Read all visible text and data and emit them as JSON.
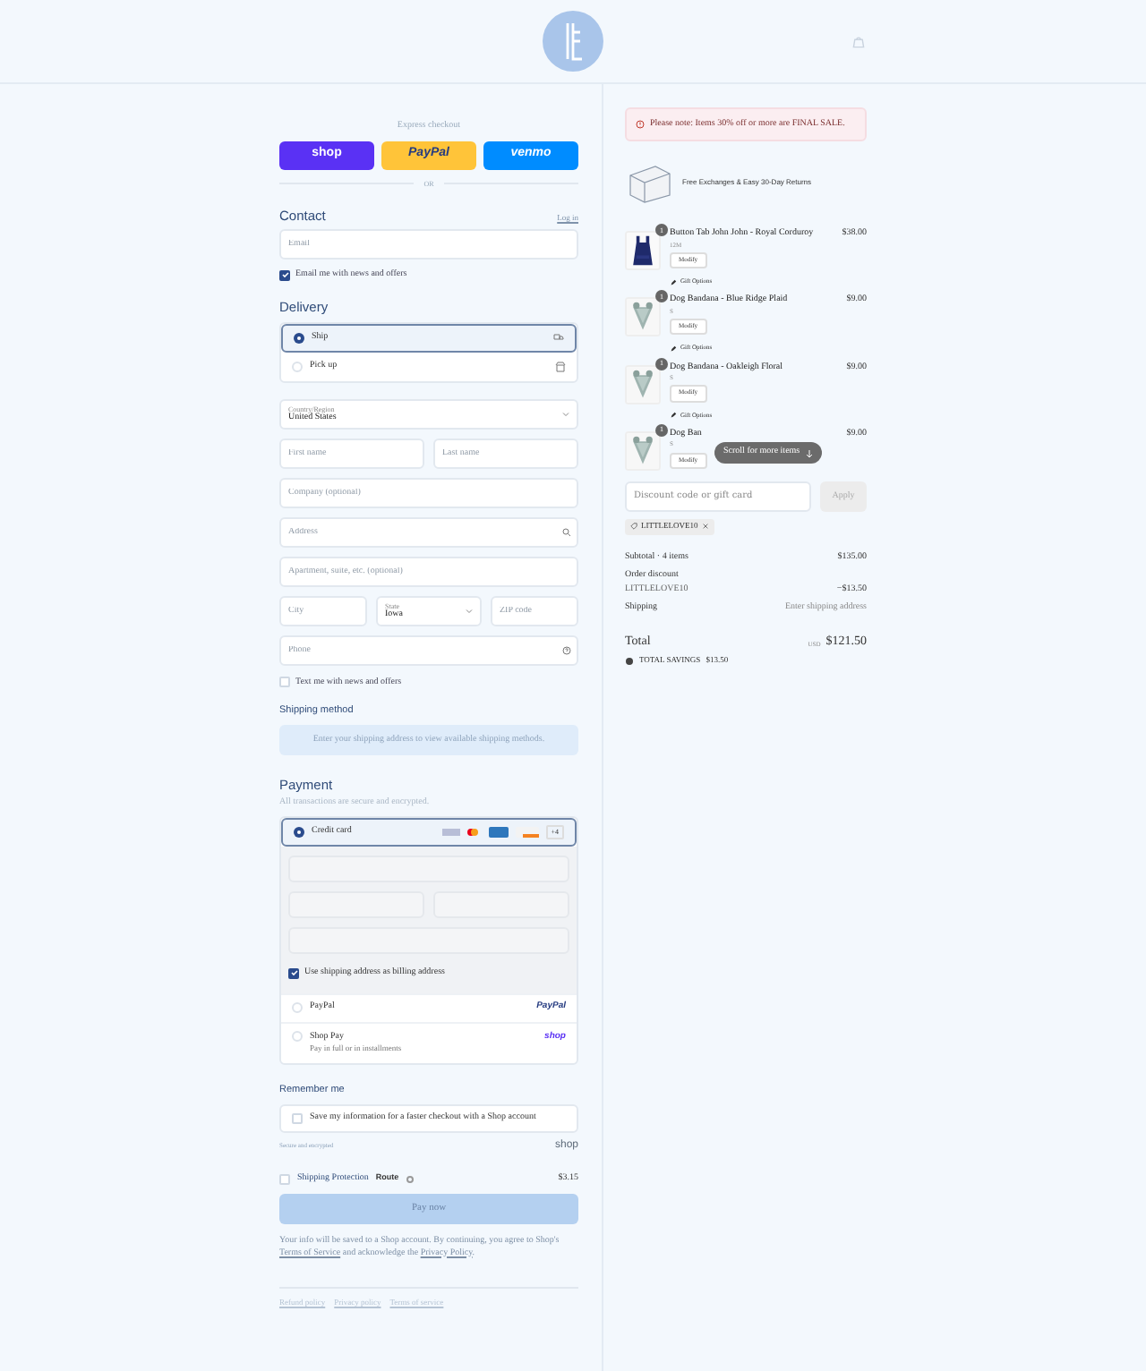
{
  "express": {
    "label": "Express checkout",
    "buttons": [
      {
        "kind": "shop",
        "label": "shop"
      },
      {
        "kind": "paypal",
        "label": "PayPal"
      },
      {
        "kind": "venmo",
        "label": "venmo"
      }
    ],
    "divider": "OR"
  },
  "contact": {
    "title": "Contact",
    "link": "Log in",
    "email": {
      "placeholder": "Email"
    },
    "newsletter": {
      "label": "Email me with news and offers",
      "checked": true
    }
  },
  "delivery": {
    "title": "Delivery",
    "options": [
      {
        "label": "Ship",
        "selected": true
      },
      {
        "label": "Pick up",
        "selected": false
      }
    ],
    "country": {
      "label": "Country/Region",
      "value": "United States"
    },
    "rows": [
      [
        {
          "kind": "text",
          "placeholder": "First name"
        },
        {
          "kind": "text",
          "placeholder": "Last name"
        }
      ],
      [
        {
          "kind": "text",
          "placeholder": "Company (optional)"
        }
      ],
      [
        {
          "kind": "search",
          "placeholder": "Address"
        }
      ],
      [
        {
          "kind": "text",
          "placeholder": "Apartment, suite, etc. (optional)"
        }
      ],
      [
        {
          "kind": "text",
          "placeholder": "City"
        },
        {
          "kind": "select",
          "label": "State",
          "value": "Iowa"
        },
        {
          "kind": "text",
          "placeholder": "ZIP code"
        }
      ],
      [
        {
          "kind": "help",
          "placeholder": "Phone"
        }
      ]
    ],
    "sms": {
      "label": "Text me with news and offers",
      "checked": false
    }
  },
  "shipping_method": {
    "title": "Shipping method",
    "message": "Enter your shipping address to view available shipping methods."
  },
  "payment": {
    "title": "Payment",
    "subtitle": "All transactions are secure and encrypted.",
    "methods": [
      {
        "kind": "card",
        "label": "Credit card",
        "selected": true,
        "more": "+4"
      },
      {
        "kind": "paypal",
        "label": "PayPal",
        "badge": "PayPal",
        "selected": false
      },
      {
        "kind": "shoppay",
        "label": "Shop Pay",
        "sublabel": "Pay in full or in installments",
        "badge": "shop",
        "selected": false
      }
    ],
    "billing": {
      "label": "Use shipping address as billing address",
      "checked": true
    }
  },
  "remember": {
    "title": "Remember me",
    "save": {
      "label": "Save my information for a faster checkout with a Shop account",
      "checked": false
    },
    "secure": "Secure and encrypted",
    "brand": "shop"
  },
  "protection": {
    "label": "Shipping Protection",
    "brand": "Route",
    "price": "$3.15",
    "checked": false
  },
  "pay_button": "Pay now",
  "legal": {
    "before": "Your info will be saved to a Shop account. By continuing, you agree to Shop's",
    "link_1": "Terms of Service",
    "middle": "and acknowledge the",
    "link_2": "Privacy Policy",
    "after": "."
  },
  "footer_links": [
    "Refund policy",
    "Privacy policy",
    "Terms of service"
  ],
  "notice": "Please note: Items 30% off or more are FINAL SALE.",
  "banner": "Free Exchanges & Easy 30-Day Returns",
  "items": [
    {
      "kind": "romper",
      "name": "Button Tab John John - Royal Corduroy",
      "variant": "12M",
      "price": "$38.00",
      "quantity": "1",
      "action": "Modify",
      "gift": "Gift Options"
    },
    {
      "kind": "bandana",
      "name": "Dog Bandana - Blue Ridge Plaid",
      "variant": "S",
      "price": "$9.00",
      "quantity": "1",
      "action": "Modify",
      "gift": "Gift Options"
    },
    {
      "kind": "bandana",
      "name": "Dog Bandana - Oakleigh Floral",
      "variant": "S",
      "price": "$9.00",
      "quantity": "1",
      "action": "Modify",
      "gift": "Gift Options"
    },
    {
      "kind": "bandana",
      "name": "Dog Ban",
      "variant": "S",
      "price": "$9.00",
      "quantity": "1",
      "action": "Modify"
    }
  ],
  "toast": "Scroll for more items",
  "discount": {
    "placeholder": "Discount code or gift card",
    "button": "Apply",
    "code": "LITTLELOVE10"
  },
  "summary": {
    "subtotal_label": "Subtotal · 4 items",
    "subtotal": "$135.00",
    "discount_label": "Order discount",
    "discount_code": "LITTLELOVE10",
    "discount_amount": "−$13.50",
    "shipping_label": "Shipping",
    "shipping_value": "Enter shipping address",
    "total_label": "Total",
    "currency": "USD",
    "total": "$121.50",
    "savings_label": "TOTAL SAVINGS",
    "savings": "$13.50"
  }
}
